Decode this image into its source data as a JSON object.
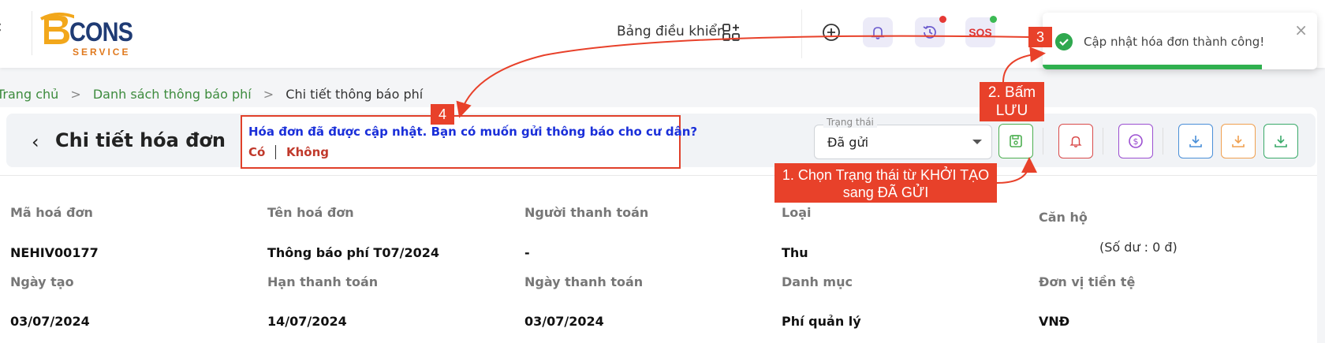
{
  "header": {
    "logo_text": "CONS",
    "logo_sub": "SERVICE",
    "dashboard_label": "Bảng điều khiển",
    "sos_label": "SOS"
  },
  "toast": {
    "message": "Cập nhật hóa đơn thành công!",
    "close": "×"
  },
  "breadcrumb": {
    "home": "Trang chủ",
    "list": "Danh sách thông báo phí",
    "current": "Chi tiết thông báo phí",
    "separator": ">"
  },
  "page": {
    "back": "<",
    "title": "Chi tiết hóa đơn"
  },
  "prompt": {
    "question": "Hóa đơn đã được cập nhật. Bạn có muốn gửi thông báo cho cư dân?",
    "yes": "Có",
    "no": "Không"
  },
  "status": {
    "label": "Trạng thái",
    "value": "Đã gửi"
  },
  "annotations": {
    "step1": "1. Chọn Trạng thái từ KHỞI TẠO sang ĐÃ GỬI",
    "step2": "2. Bấm LƯU",
    "step3": "3",
    "step4": "4"
  },
  "fields": {
    "row1": [
      {
        "label": "Mã hoá đơn",
        "value": "NEHIV00177"
      },
      {
        "label": "Tên hoá đơn",
        "value": "Thông báo phí T07/2024"
      },
      {
        "label": "Người thanh toán",
        "value": "-"
      },
      {
        "label": "Loại",
        "value": "Thu"
      },
      {
        "label": "Căn hộ",
        "value": ""
      }
    ],
    "balance": "(Số dư : 0 đ)",
    "row2": [
      {
        "label": "Ngày tạo",
        "value": "03/07/2024"
      },
      {
        "label": "Hạn thanh toán",
        "value": "14/07/2024"
      },
      {
        "label": "Ngày thanh toán",
        "value": "03/07/2024"
      },
      {
        "label": "Danh mục",
        "value": "Phí quản lý"
      },
      {
        "label": "Đơn vị tiền tệ",
        "value": "VNĐ"
      }
    ]
  },
  "toast_progress": 0.8,
  "colors": {
    "annotation": "#e8412a",
    "success": "#2fa84f",
    "link": "#3d8b3d",
    "prompt": "#1a2fd9"
  }
}
